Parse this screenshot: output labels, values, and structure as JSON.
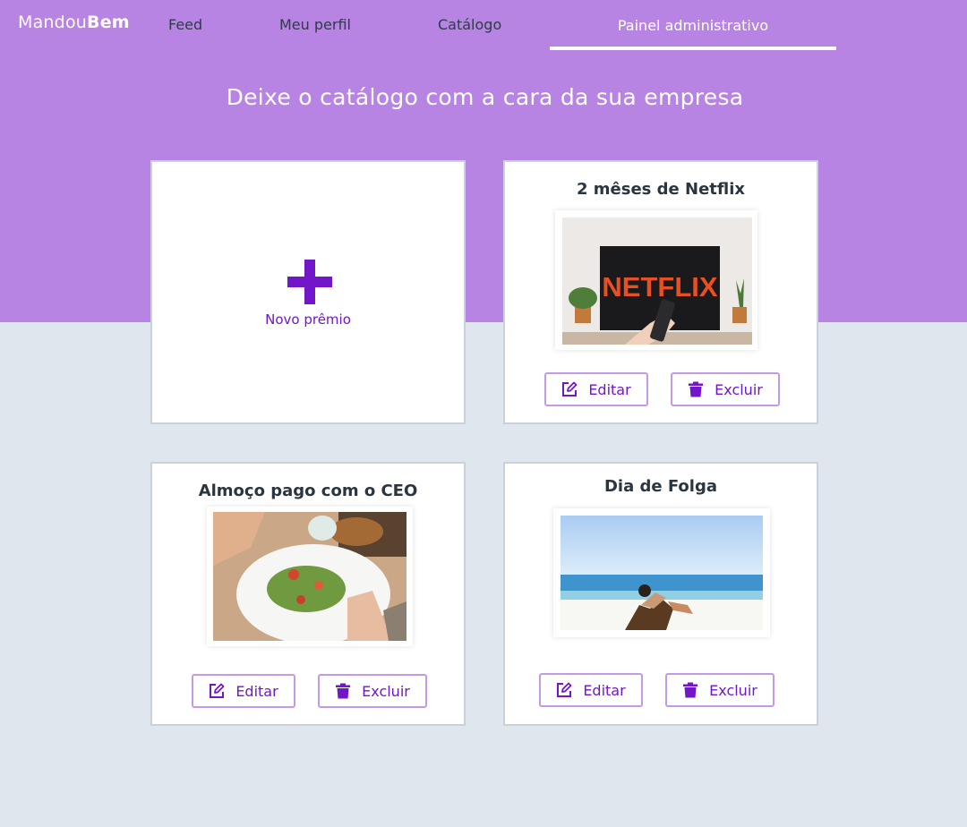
{
  "brand": {
    "part1": "Mandou",
    "part2": "Bem"
  },
  "nav": {
    "feed": "Feed",
    "perfil": "Meu perfil",
    "catalogo": "Catálogo",
    "painel": "Painel administrativo",
    "active": "painel"
  },
  "hero": {
    "title": "Deixe o catálogo com a cara da sua empresa"
  },
  "new_prize": {
    "label": "Novo prêmio",
    "icon": "plus-icon"
  },
  "prizes": [
    {
      "title": "2 mêses de Netflix",
      "edit_label": "Editar",
      "delete_label": "Excluir"
    },
    {
      "title": "Almoço pago com o CEO",
      "edit_label": "Editar",
      "delete_label": "Excluir"
    },
    {
      "title": "Dia de Folga",
      "edit_label": "Editar",
      "delete_label": "Excluir"
    }
  ],
  "icons": {
    "edit": "pencil-square-icon",
    "delete": "trash-icon"
  },
  "colors": {
    "hero_bg": "#b884e4",
    "page_bg": "#e0e6ee",
    "accent": "#7216c9",
    "button_border": "#c39ae8"
  }
}
